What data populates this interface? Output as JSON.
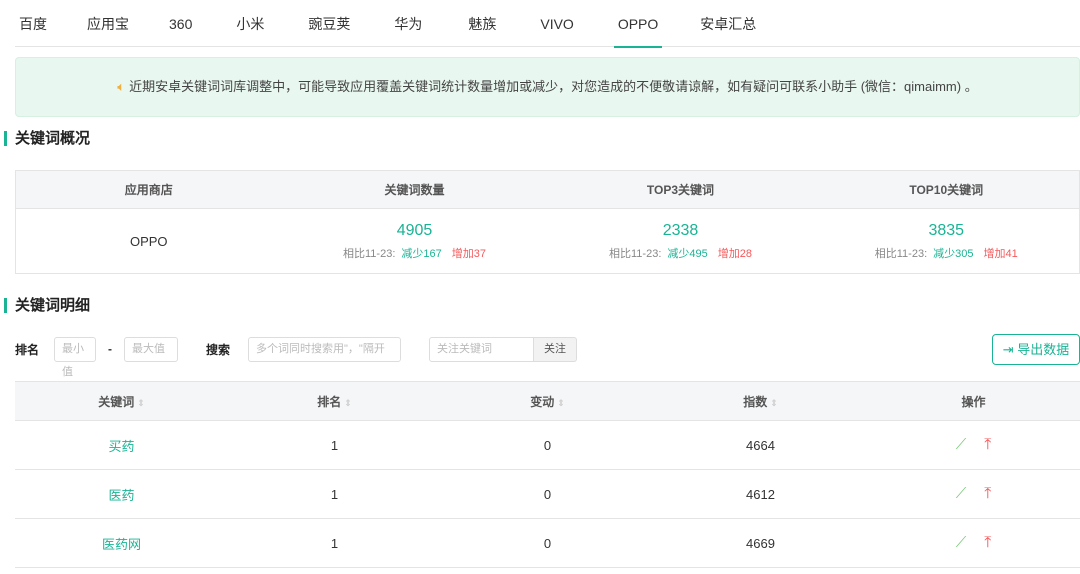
{
  "tabs": [
    "百度",
    "应用宝",
    "360",
    "小米",
    "豌豆荚",
    "华为",
    "魅族",
    "VIVO",
    "OPPO",
    "安卓汇总"
  ],
  "active_tab": "OPPO",
  "notice": "近期安卓关键词词库调整中，可能导致应用覆盖关键词统计数量增加或减少，对您造成的不便敬请谅解，如有疑问可联系小助手 (微信：qimaimm) 。",
  "overview": {
    "title": "关键词概况",
    "headers": [
      "应用商店",
      "关键词数量",
      "TOP3关键词",
      "TOP10关键词"
    ],
    "store": "OPPO",
    "cells": [
      {
        "value": "4905",
        "compare": "相比11-23:",
        "down": "减少167",
        "up": "增加37"
      },
      {
        "value": "2338",
        "compare": "相比11-23:",
        "down": "减少495",
        "up": "增加28"
      },
      {
        "value": "3835",
        "compare": "相比11-23:",
        "down": "减少305",
        "up": "增加41"
      }
    ]
  },
  "detail": {
    "title": "关键词明细",
    "filter": {
      "rank_label": "排名",
      "min_placeholder": "最小值",
      "dash": "-",
      "max_placeholder": "最大值",
      "search_label": "搜索",
      "search_placeholder": "多个词同时搜索用\"，\"隔开",
      "follow_placeholder": "关注关键词",
      "follow_button": "关注"
    },
    "export_label": "导出数据",
    "headers": [
      "关键词",
      "排名",
      "变动",
      "指数",
      "操作"
    ],
    "rows": [
      {
        "keyword": "买药",
        "rank": "1",
        "change": "0",
        "index": "4664"
      },
      {
        "keyword": "医药",
        "rank": "1",
        "change": "0",
        "index": "4612"
      },
      {
        "keyword": "医药网",
        "rank": "1",
        "change": "0",
        "index": "4669"
      }
    ]
  },
  "colors": {
    "accent": "#1ab394",
    "danger": "#f5585a"
  }
}
